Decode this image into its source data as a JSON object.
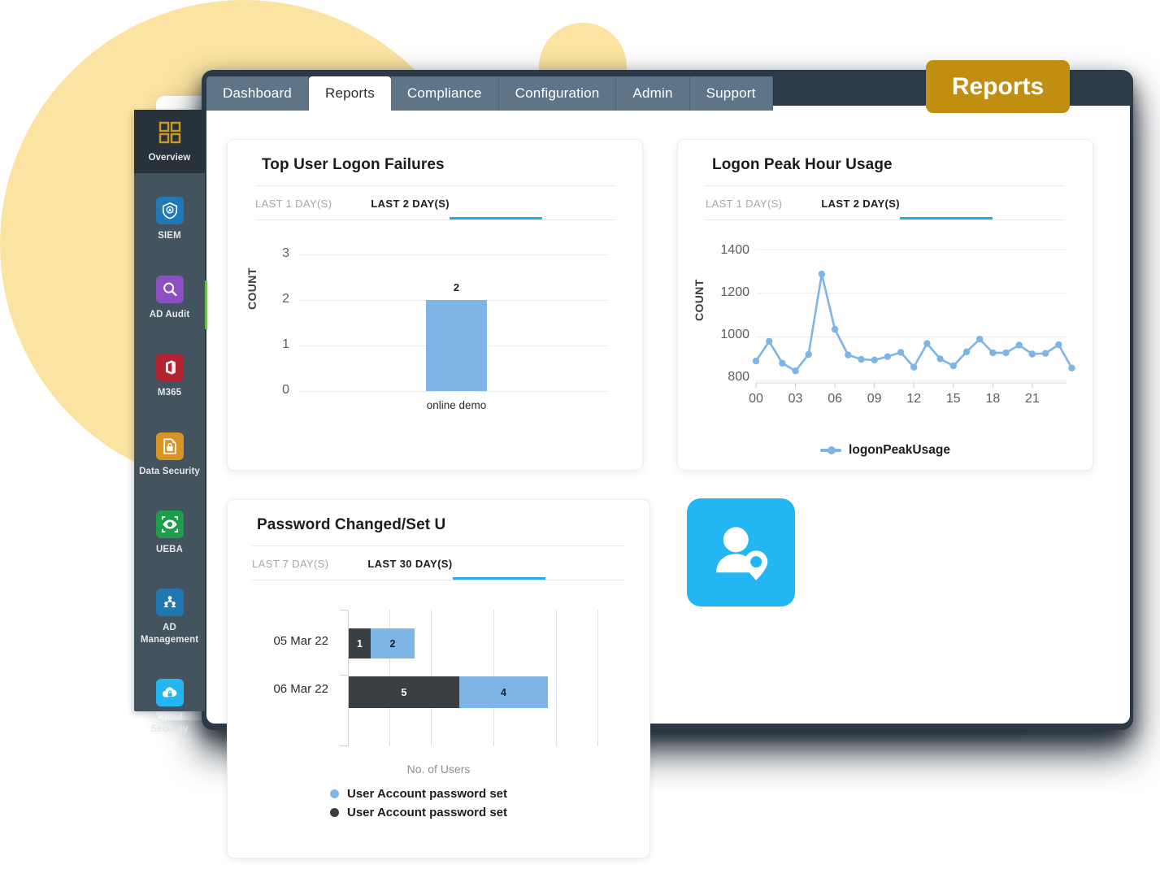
{
  "badge": {
    "label": "Reports"
  },
  "tabs": [
    {
      "label": "Dashboard",
      "active": false
    },
    {
      "label": "Reports",
      "active": true
    },
    {
      "label": "Compliance",
      "active": false
    },
    {
      "label": "Configuration",
      "active": false
    },
    {
      "label": "Admin",
      "active": false
    },
    {
      "label": "Support",
      "active": false
    }
  ],
  "sidebar": {
    "items": [
      {
        "label": "Overview",
        "icon": "grid-icon",
        "icon_color": "#c9972a",
        "active": true
      },
      {
        "label": "SIEM",
        "icon": "shield-icon",
        "icon_color": "#1f78b8",
        "active": false
      },
      {
        "label": "AD Audit",
        "icon": "magnifier-icon",
        "icon_color": "#8c4fc2",
        "active": false
      },
      {
        "label": "M365",
        "icon": "office-icon",
        "icon_color": "#b32430",
        "active": false
      },
      {
        "label": "Data Security",
        "icon": "file-lock-icon",
        "icon_color": "#d79427",
        "active": false
      },
      {
        "label": "UEBA",
        "icon": "eye-icon",
        "icon_color": "#1d9e4b",
        "active": false
      },
      {
        "label": "AD Management",
        "icon": "people-icon",
        "icon_color": "#2178b0",
        "active": false
      },
      {
        "label": "Cloud Security",
        "icon": "cloud-lock-icon",
        "icon_color": "#23b6f2",
        "active": false
      }
    ]
  },
  "decor": {
    "user_location_icon": "user-location-icon",
    "accent_blue": "#2aaae2",
    "accent_gold": "#c08e10",
    "blob_yellow": "#fbe3a2"
  },
  "cards": {
    "logon_failures": {
      "title": "Top User Logon Failures",
      "range_tabs": [
        {
          "label": "LAST 1 DAY(S)",
          "active": false
        },
        {
          "label": "LAST 2 DAY(S)",
          "active": true
        }
      ]
    },
    "peak_usage": {
      "title": "Logon Peak Hour Usage",
      "range_tabs": [
        {
          "label": "LAST 1 DAY(S)",
          "active": false
        },
        {
          "label": "LAST 2 DAY(S)",
          "active": true
        }
      ]
    },
    "password_changed": {
      "title": "Password Changed/Set U",
      "range_tabs": [
        {
          "label": "LAST 7 DAY(S)",
          "active": false
        },
        {
          "label": "LAST 30 DAY(S)",
          "active": true
        }
      ]
    }
  },
  "chart_data": [
    {
      "id": "top-user-logon-failures",
      "type": "bar",
      "title": "Top User Logon Failures",
      "xlabel": "",
      "ylabel": "COUNT",
      "categories": [
        "online demo"
      ],
      "values": [
        2
      ],
      "data_labels": [
        "2"
      ],
      "yticks": [
        0,
        1,
        2,
        3
      ],
      "ylim": [
        0,
        3
      ],
      "grid": true,
      "series_color": "#7db5e6",
      "legend": "none"
    },
    {
      "id": "logon-peak-hour-usage",
      "type": "line",
      "title": "Logon Peak Hour Usage",
      "xlabel": "",
      "ylabel": "COUNT",
      "yticks": [
        800,
        1000,
        1200,
        1400
      ],
      "ylim": [
        790,
        1400
      ],
      "xticks": [
        "00",
        "03",
        "06",
        "09",
        "12",
        "15",
        "18",
        "21"
      ],
      "xlim": [
        0,
        23
      ],
      "grid": true,
      "legend": "bottom",
      "series": [
        {
          "name": "logonPeakUsage",
          "color": "#7db5e6",
          "x": [
            0,
            1,
            2,
            3,
            4,
            5,
            6,
            7,
            8,
            9,
            10,
            11,
            12,
            13,
            14,
            15,
            16,
            17,
            18,
            19,
            20,
            21,
            22,
            23
          ],
          "values": [
            890,
            980,
            880,
            845,
            920,
            1288,
            1035,
            918,
            898,
            895,
            910,
            930,
            862,
            970,
            900,
            868,
            932,
            990,
            928,
            928,
            963,
            922,
            925,
            965
          ]
        }
      ],
      "note_points": [
        {
          "x": 24,
          "y": 858
        }
      ]
    },
    {
      "id": "password-changed-set-users",
      "type": "bar",
      "orientation": "horizontal",
      "stacked": true,
      "title": "Password Changed/Set U",
      "xlabel": "No. of Users",
      "ylabel": "",
      "categories": [
        "05 Mar 22",
        "06 Mar 22"
      ],
      "xlim": [
        0,
        12
      ],
      "grid": true,
      "legend": "bottom",
      "series": [
        {
          "name": "User Account password set",
          "color": "#3a3f44",
          "values": [
            1,
            5
          ],
          "legend_order": 2
        },
        {
          "name": "User Account password set",
          "color": "#7db5e6",
          "values": [
            2,
            4
          ],
          "legend_order": 1
        }
      ]
    }
  ]
}
